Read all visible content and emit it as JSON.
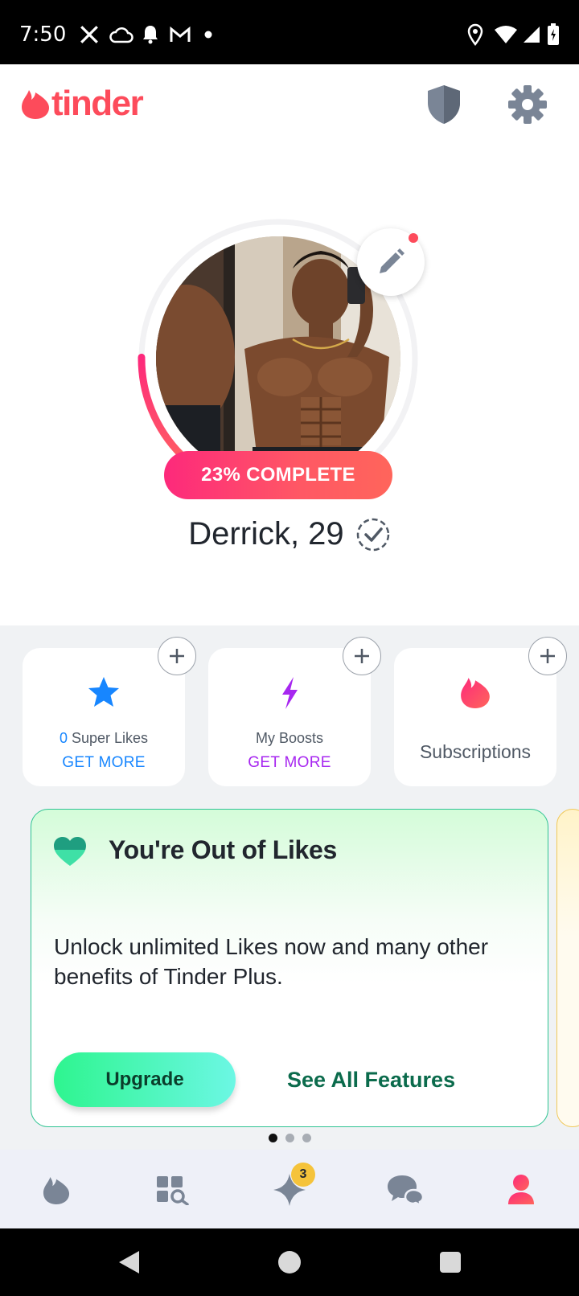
{
  "status_bar": {
    "time": "7:50",
    "icons": [
      "x-icon",
      "cloud-icon",
      "bell-icon",
      "gmail-icon",
      "dot-icon",
      "location-icon",
      "wifi-icon",
      "signal-icon",
      "battery-icon"
    ]
  },
  "header": {
    "logo_text": "tinder",
    "icons": [
      "shield-icon",
      "gear-icon"
    ]
  },
  "profile": {
    "completion": 0.23,
    "completion_label": "23% COMPLETE",
    "name_age": "Derrick, 29",
    "photo_alt": "profile photo"
  },
  "cards": [
    {
      "icon": "star-icon",
      "count": "0",
      "label": "Super Likes",
      "cta": "GET MORE",
      "accent": "#1786ff"
    },
    {
      "icon": "bolt-icon",
      "label": "My Boosts",
      "cta": "GET MORE",
      "accent": "#a727f0"
    },
    {
      "icon": "flame-icon",
      "label": "Subscriptions",
      "accent": "#fd4b5b"
    }
  ],
  "upsell": {
    "title": "You're Out of Likes",
    "body": "Unlock unlimited Likes now and many other benefits of Tinder Plus.",
    "primary_button": "Upgrade",
    "secondary_button": "See All Features"
  },
  "carousel": {
    "pages": 3,
    "active": 0
  },
  "bottom_nav": {
    "items": [
      "flame-icon",
      "explore-icon",
      "sparkle-icon",
      "chat-icon",
      "profile-icon"
    ],
    "badge": "3",
    "active": "profile-icon"
  },
  "colors": {
    "brand": "#fd4b5b",
    "gradient_start": "#fd297b",
    "gradient_end": "#ff655b",
    "green": "#2ef58f"
  }
}
